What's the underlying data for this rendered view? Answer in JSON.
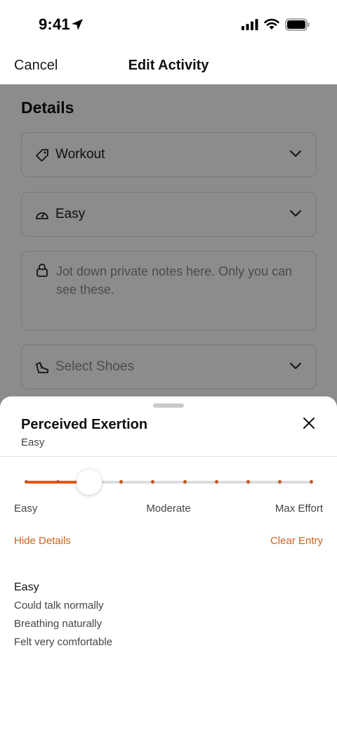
{
  "status": {
    "time": "9:41"
  },
  "nav": {
    "cancel": "Cancel",
    "title": "Edit Activity"
  },
  "details": {
    "section_title": "Details",
    "activity_type": "Workout",
    "effort": "Easy",
    "notes_placeholder": "Jot down private notes here. Only you can see these.",
    "shoes_placeholder": "Select Shoes"
  },
  "sheet": {
    "title": "Perceived Exertion",
    "subtitle": "Easy",
    "slider": {
      "value": 3,
      "min": 1,
      "max": 10
    },
    "scale_labels": {
      "min": "Easy",
      "mid": "Moderate",
      "max": "Max Effort"
    },
    "hide_details": "Hide Details",
    "clear_entry": "Clear Entry",
    "detail": {
      "heading": "Easy",
      "lines": [
        "Could talk normally",
        "Breathing naturally",
        "Felt very comfortable"
      ]
    }
  },
  "colors": {
    "accent": "#e05a14",
    "link": "#d0621b",
    "overlay": "rgba(0,0,0,0.45)"
  },
  "icons": {
    "location": "location-arrow-icon",
    "signal": "cellular-signal-icon",
    "wifi": "wifi-icon",
    "battery": "battery-icon",
    "type": "tag-icon",
    "effort": "speedometer-icon",
    "notes": "lock-icon",
    "shoes": "shoe-icon",
    "close": "close-icon"
  }
}
